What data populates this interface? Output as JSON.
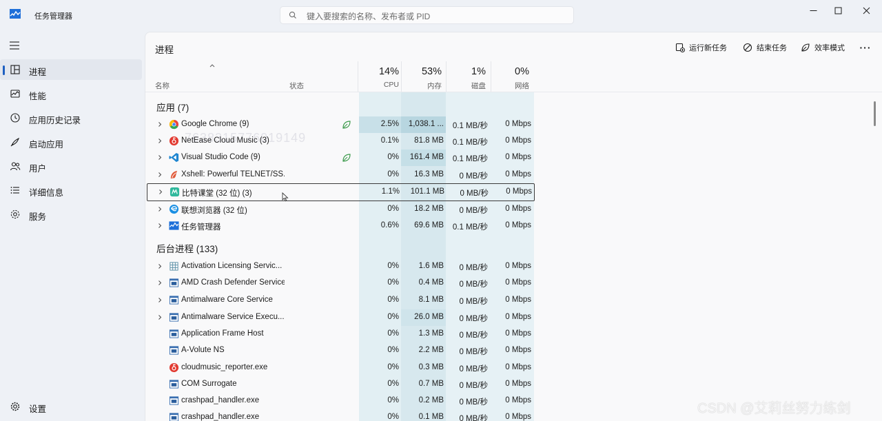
{
  "window": {
    "title": "任务管理器",
    "search_placeholder": "键入要搜索的名称、发布者或 PID"
  },
  "sidebar": {
    "items": [
      {
        "label": "进程",
        "icon": "processes-icon",
        "active": true
      },
      {
        "label": "性能",
        "icon": "performance-icon",
        "active": false
      },
      {
        "label": "应用历史记录",
        "icon": "app-history-icon",
        "active": false
      },
      {
        "label": "启动应用",
        "icon": "startup-apps-icon",
        "active": false
      },
      {
        "label": "用户",
        "icon": "users-icon",
        "active": false
      },
      {
        "label": "详细信息",
        "icon": "details-icon",
        "active": false
      },
      {
        "label": "服务",
        "icon": "services-icon",
        "active": false
      }
    ],
    "settings_label": "设置"
  },
  "main": {
    "title": "进程",
    "toolbar": {
      "run_new_task": "运行新任务",
      "end_task": "结束任务",
      "efficiency_mode": "效率模式"
    },
    "columns": {
      "name": "名称",
      "status": "状态",
      "cpu_pct": "14%",
      "cpu": "CPU",
      "mem_pct": "53%",
      "mem": "内存",
      "disk_pct": "1%",
      "disk": "磁盘",
      "net_pct": "0%",
      "net": "网络"
    },
    "groups": [
      {
        "title": "应用 (7)",
        "rows": [
          {
            "name": "Google Chrome (9)",
            "icon": "chrome-icon",
            "expandable": true,
            "eco": true,
            "cpu": "2.5%",
            "mem": "1,038.1 ...",
            "disk": "0.1 MB/秒",
            "net": "0 Mbps"
          },
          {
            "name": "NetEase Cloud Music (3)",
            "icon": "netease-music-icon",
            "expandable": true,
            "eco": false,
            "cpu": "0.1%",
            "mem": "81.8 MB",
            "disk": "0.1 MB/秒",
            "net": "0 Mbps"
          },
          {
            "name": "Visual Studio Code (9)",
            "icon": "vscode-icon",
            "expandable": true,
            "eco": true,
            "cpu": "0%",
            "mem": "161.4 MB",
            "disk": "0.1 MB/秒",
            "net": "0 Mbps"
          },
          {
            "name": "Xshell: Powerful TELNET/SS...",
            "icon": "xshell-icon",
            "expandable": true,
            "eco": false,
            "cpu": "0%",
            "mem": "16.3 MB",
            "disk": "0 MB/秒",
            "net": "0 Mbps"
          },
          {
            "name": "比特课堂 (32 位) (3)",
            "icon": "bite-class-icon",
            "expandable": true,
            "eco": false,
            "cpu": "1.1%",
            "mem": "101.1 MB",
            "disk": "0 MB/秒",
            "net": "0 Mbps",
            "selected": true
          },
          {
            "name": "联想浏览器 (32 位)",
            "icon": "lenovo-browser-icon",
            "expandable": true,
            "eco": false,
            "cpu": "0%",
            "mem": "18.2 MB",
            "disk": "0 MB/秒",
            "net": "0 Mbps"
          },
          {
            "name": "任务管理器",
            "icon": "task-manager-icon",
            "expandable": true,
            "eco": false,
            "cpu": "0.6%",
            "mem": "69.6 MB",
            "disk": "0.1 MB/秒",
            "net": "0 Mbps"
          }
        ]
      },
      {
        "title": "后台进程 (133)",
        "rows": [
          {
            "name": "Activation Licensing Servic...",
            "icon": "grid-service-icon",
            "expandable": true,
            "eco": false,
            "cpu": "0%",
            "mem": "1.6 MB",
            "disk": "0 MB/秒",
            "net": "0 Mbps"
          },
          {
            "name": "AMD Crash Defender Service",
            "icon": "window-app-icon",
            "expandable": true,
            "eco": false,
            "cpu": "0%",
            "mem": "0.4 MB",
            "disk": "0 MB/秒",
            "net": "0 Mbps"
          },
          {
            "name": "Antimalware Core Service",
            "icon": "window-app-icon",
            "expandable": true,
            "eco": false,
            "cpu": "0%",
            "mem": "8.1 MB",
            "disk": "0 MB/秒",
            "net": "0 Mbps"
          },
          {
            "name": "Antimalware Service Execu...",
            "icon": "window-app-icon",
            "expandable": true,
            "eco": false,
            "cpu": "0%",
            "mem": "26.0 MB",
            "disk": "0 MB/秒",
            "net": "0 Mbps"
          },
          {
            "name": "Application Frame Host",
            "icon": "window-app-icon",
            "expandable": false,
            "eco": false,
            "cpu": "0%",
            "mem": "1.3 MB",
            "disk": "0 MB/秒",
            "net": "0 Mbps"
          },
          {
            "name": "A-Volute NS",
            "icon": "window-app-icon",
            "expandable": false,
            "eco": false,
            "cpu": "0%",
            "mem": "2.2 MB",
            "disk": "0 MB/秒",
            "net": "0 Mbps"
          },
          {
            "name": "cloudmusic_reporter.exe",
            "icon": "netease-music-icon",
            "expandable": false,
            "eco": false,
            "cpu": "0%",
            "mem": "0.3 MB",
            "disk": "0 MB/秒",
            "net": "0 Mbps"
          },
          {
            "name": "COM Surrogate",
            "icon": "window-app-icon",
            "expandable": false,
            "eco": false,
            "cpu": "0%",
            "mem": "0.7 MB",
            "disk": "0 MB/秒",
            "net": "0 Mbps"
          },
          {
            "name": "crashpad_handler.exe",
            "icon": "window-app-icon",
            "expandable": false,
            "eco": false,
            "cpu": "0%",
            "mem": "0.2 MB",
            "disk": "0 MB/秒",
            "net": "0 Mbps"
          },
          {
            "name": "crashpad_handler.exe",
            "icon": "window-app-icon",
            "expandable": false,
            "eco": false,
            "cpu": "0%",
            "mem": "0.1 MB",
            "disk": "0 MB/秒",
            "net": "0 Mbps"
          }
        ]
      }
    ]
  },
  "overlay_text": "7638315776019149",
  "watermark": "CSDN @艾莉丝努力练剑",
  "colors": {
    "accent": "#1d5fc1",
    "heat_light": "#e3eff4",
    "heat_mid": "#d2e6ec",
    "eco_green": "#3d9b4c"
  }
}
